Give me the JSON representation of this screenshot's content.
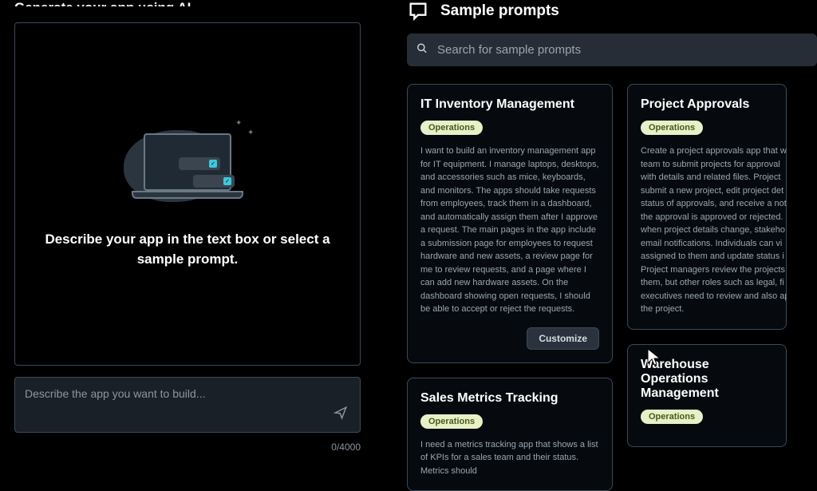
{
  "page_title": "Generate your app using AI",
  "instruction": "Describe your app in the text box or select a sample prompt.",
  "input": {
    "placeholder": "Describe the app you want to build...",
    "counter": "0/4000"
  },
  "sample_prompts": {
    "header": "Sample prompts",
    "search_placeholder": "Search for sample prompts"
  },
  "cards": [
    {
      "title": "IT Inventory Management",
      "badge": "Operations",
      "desc": "I want to build an inventory management app for IT equipment. I manage laptops, desktops, and accessories such as mice, keyboards, and monitors. The apps should take requests from employees, track them in a dashboard, and automatically assign them after I approve a request. The main pages in the app include a submission page for employees to request hardware and new assets, a review page for me to review requests, and a page where I can add new hardware assets. On the dashboard showing open requests, I should be able to accept or reject the requests.",
      "button": "Customize"
    },
    {
      "title": "Project Approvals",
      "badge": "Operations",
      "desc_lines": [
        "Create a project approvals app that w",
        "team to submit projects for approval",
        "with details and related files. Project",
        "submit a new project, edit project det",
        "status of approvals, and receive a not",
        "the approval is approved or rejected.",
        "when project details change, stakeho",
        "email notifications. Individuals can vi",
        "assigned to them and update status i",
        "Project managers review the projects",
        "them, but other roles such as legal, fi",
        "executives need to review and also ap",
        "the project."
      ]
    },
    {
      "title": "Sales Metrics Tracking",
      "badge": "Operations",
      "desc": "I need a metrics tracking app that shows a list of KPIs for a sales team and their status. Metrics should"
    },
    {
      "title": "Warehouse Operations Management",
      "badge": "Operations"
    }
  ]
}
